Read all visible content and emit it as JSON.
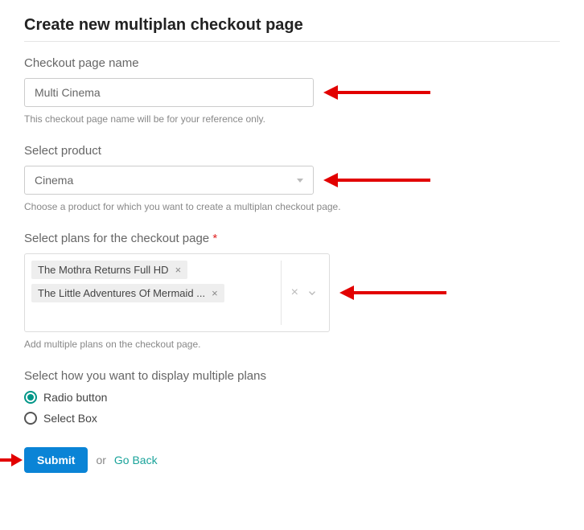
{
  "page_title": "Create new multiplan checkout page",
  "fields": {
    "name": {
      "label": "Checkout page name",
      "value": "Multi Cinema",
      "helper": "This checkout page name will be for your reference only."
    },
    "product": {
      "label": "Select product",
      "value": "Cinema",
      "helper": "Choose a product for which you want to create a multiplan checkout page."
    },
    "plans": {
      "label": "Select plans for the checkout page",
      "required_mark": "*",
      "chips": [
        {
          "label": "The Mothra Returns Full HD"
        },
        {
          "label": "The Little Adventures Of Mermaid ..."
        }
      ],
      "helper": "Add multiple plans on the checkout page."
    },
    "display": {
      "label": "Select how you want to display multiple plans",
      "options": [
        {
          "label": "Radio button",
          "selected": true
        },
        {
          "label": "Select Box",
          "selected": false
        }
      ]
    }
  },
  "actions": {
    "submit": "Submit",
    "or": "or",
    "go_back": "Go Back"
  }
}
